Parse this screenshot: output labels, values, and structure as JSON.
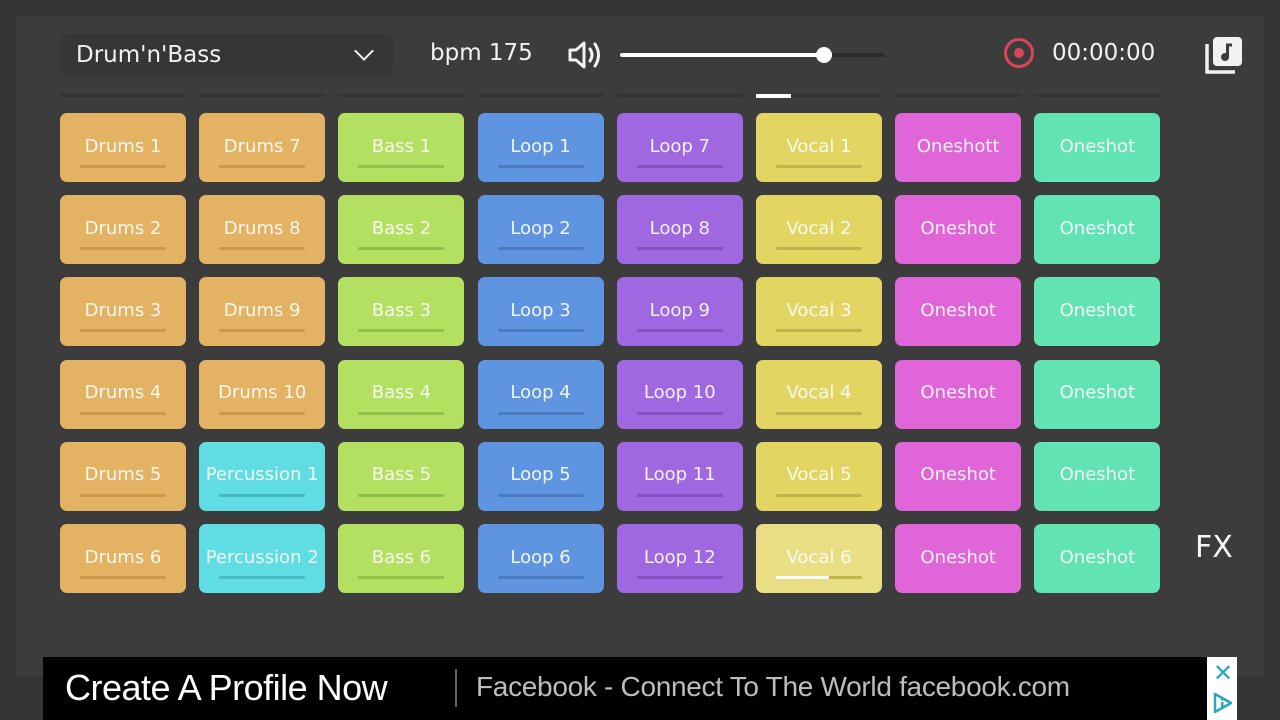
{
  "header": {
    "preset": "Drum'n'Bass",
    "bpm_label": "bpm 175",
    "volume": 0.88,
    "timer": "00:00:00",
    "record_color": "#d9465b"
  },
  "fx_label": "FX",
  "columns": [
    {
      "color": "#e3b262",
      "bar": "#c99a4a",
      "pads": [
        "Drums 1",
        "Drums 2",
        "Drums 3",
        "Drums 4",
        "Drums 5",
        "Drums 6"
      ]
    },
    {
      "color": "#e3b262",
      "bar": "#c99a4a",
      "pads": [
        "Drums 7",
        "Drums 8",
        "Drums 9",
        "Drums 10",
        "Percussion 1",
        "Percussion 2"
      ]
    },
    {
      "color": "#b4e062",
      "bar": "#93bf48",
      "pads": [
        "Bass 1",
        "Bass 2",
        "Bass 3",
        "Bass 4",
        "Bass 5",
        "Bass 6"
      ]
    },
    {
      "color": "#5f95e0",
      "bar": "#4a7bc2",
      "pads": [
        "Loop 1",
        "Loop 2",
        "Loop 3",
        "Loop 4",
        "Loop 5",
        "Loop 6"
      ]
    },
    {
      "color": "#a068e0",
      "bar": "#8650c2",
      "pads": [
        "Loop 7",
        "Loop 8",
        "Loop 9",
        "Loop 10",
        "Loop 11",
        "Loop 12"
      ]
    },
    {
      "color": "#e3d562",
      "bar": "#c2b448",
      "pads": [
        "Vocal 1",
        "Vocal 2",
        "Vocal 3",
        "Vocal 4",
        "Vocal 5",
        "Vocal 6"
      ]
    },
    {
      "color": "#e065d8",
      "bar": null,
      "pads": [
        "Oneshott",
        "Oneshot",
        "Oneshot",
        "Oneshot",
        "Oneshot",
        "Oneshot"
      ]
    },
    {
      "color": "#62e3b4",
      "bar": null,
      "pads": [
        "Oneshot",
        "Oneshot",
        "Oneshot",
        "Oneshot",
        "Oneshot",
        "Oneshot"
      ]
    }
  ],
  "percussion_color": "#5fdde3",
  "percussion_bar": "#48b9c0",
  "active_pad": {
    "column": 5,
    "row": 5,
    "color": "#e8de84",
    "progress": 0.62
  },
  "ad": {
    "title": "Create A Profile Now",
    "description": "Facebook - Connect To The World facebook.com",
    "close_glyph": "✕"
  }
}
